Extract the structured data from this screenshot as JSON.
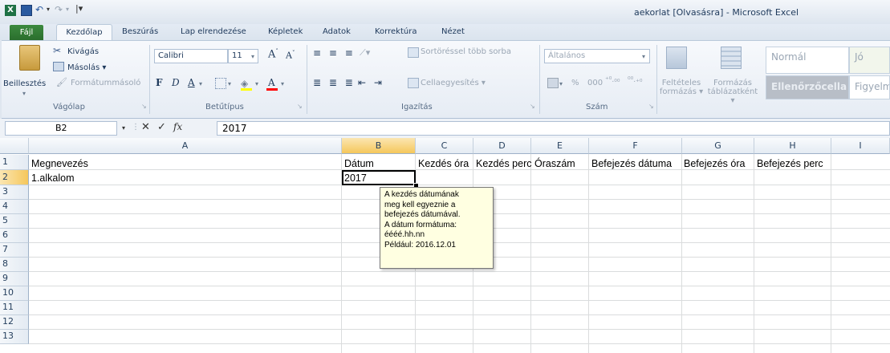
{
  "window": {
    "title": "aekorlat  [Olvasásra]  -  Microsoft Excel"
  },
  "tabs": [
    "Fájl",
    "Kezdőlap",
    "Beszúrás",
    "Lap elrendezése",
    "Képletek",
    "Adatok",
    "Korrektúra",
    "Nézet"
  ],
  "ribbon": {
    "clipboard": {
      "paste": "Beillesztés",
      "cut": "Kivágás",
      "copy": "Másolás ▾",
      "format_painter": "Formátummásoló",
      "label": "Vágólap"
    },
    "font": {
      "font_name": "Calibri",
      "font_size": "11",
      "bold": "F",
      "italic": "D",
      "underline": "A",
      "font_color": "A",
      "label": "Betűtípus"
    },
    "alignment": {
      "wrap": "Sortöréssel több sorba",
      "merge": "Cellaegyesítés ▾",
      "label": "Igazítás"
    },
    "number": {
      "format": "Általános",
      "percent": "%",
      "thousands": "000",
      "label": "Szám"
    },
    "styles": {
      "conditional": "Feltételes formázás ▾",
      "table": "Formázás táblázatként ▾",
      "normal": "Normál",
      "good": "Jó",
      "check_cell": "Ellenőrzőcella",
      "note": "Figyelm"
    }
  },
  "formula_bar": {
    "name_box": "B2",
    "fx": "fx",
    "value": "2017"
  },
  "columns": [
    "A",
    "B",
    "C",
    "D",
    "E",
    "F",
    "G",
    "H",
    "I"
  ],
  "rows": [
    "1",
    "2",
    "3",
    "4",
    "5",
    "6",
    "7",
    "8",
    "9",
    "10",
    "11",
    "12",
    "13"
  ],
  "cells": {
    "A1": "Megnevezés",
    "B1": "Dátum",
    "C1": "Kezdés óra",
    "D1": "Kezdés perc",
    "E1": "Óraszám",
    "F1": "Befejezés dátuma",
    "G1": "Befejezés óra",
    "H1": "Befejezés perc",
    "A2": "1.alkalom",
    "B2": "2017"
  },
  "tooltip": {
    "lines": [
      "A kezdés dátumának",
      "meg kell egyeznie a",
      "befejezés dátumával.",
      "A dátum formátuma:",
      "éééé.hh.nn",
      "Például: 2016.12.01"
    ]
  },
  "colors": {
    "file_tab": "#2a6e2d",
    "selected_header": "#f9d98f",
    "tooltip_bg": "#ffffe1"
  }
}
